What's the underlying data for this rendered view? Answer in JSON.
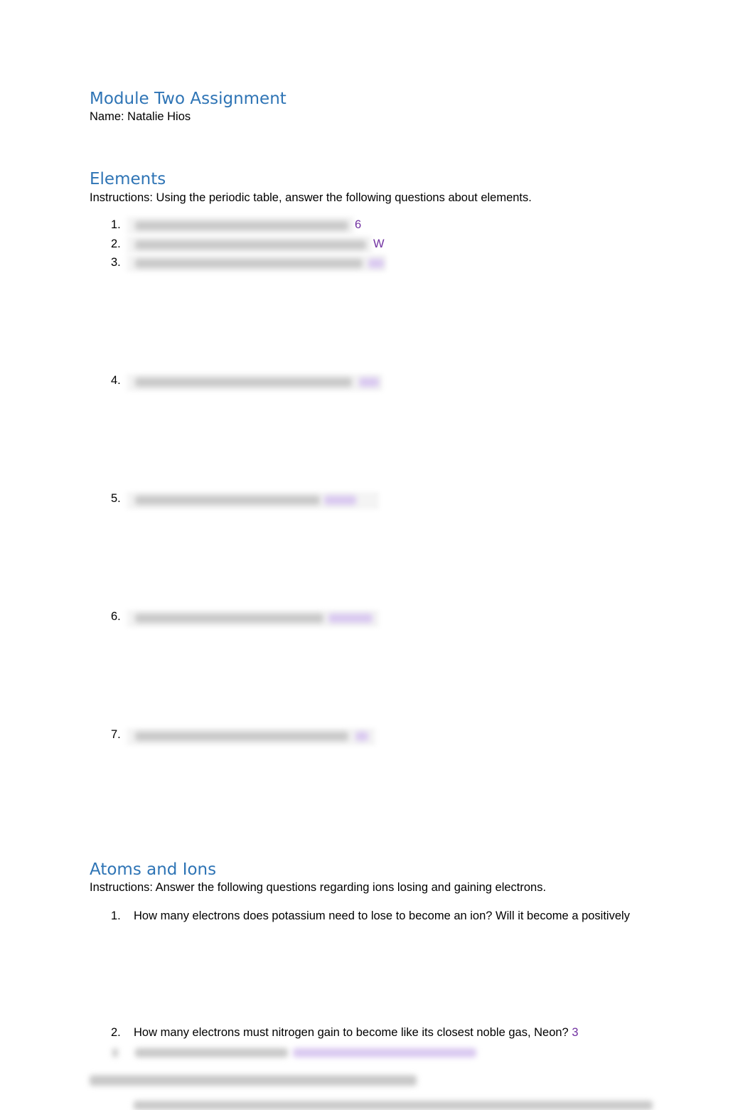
{
  "title": "Module Two Assignment",
  "name_line": "Name: Natalie Hios",
  "elements": {
    "heading": "Elements",
    "instructions": "Instructions: Using the periodic table, answer the following questions about elements.",
    "items": [
      {
        "num": "1.",
        "answer": "6"
      },
      {
        "num": "2.",
        "answer": "W"
      },
      {
        "num": "3."
      },
      {
        "num": "4."
      },
      {
        "num": "5."
      },
      {
        "num": "6."
      },
      {
        "num": "7."
      }
    ]
  },
  "atoms": {
    "heading": "Atoms and Ions",
    "instructions": "Instructions: Answer the following questions regarding ions losing and gaining electrons.",
    "items": [
      {
        "num": "1.",
        "question": "How many electrons does potassium need to lose to become an ion? Will it become a positively"
      },
      {
        "num": "2.",
        "question": "How many electrons must nitrogen gain to become like its closest noble gas, Neon?",
        "answer": "3"
      }
    ]
  },
  "colors": {
    "heading": "#2e74b5",
    "answer": "#7030a0"
  }
}
